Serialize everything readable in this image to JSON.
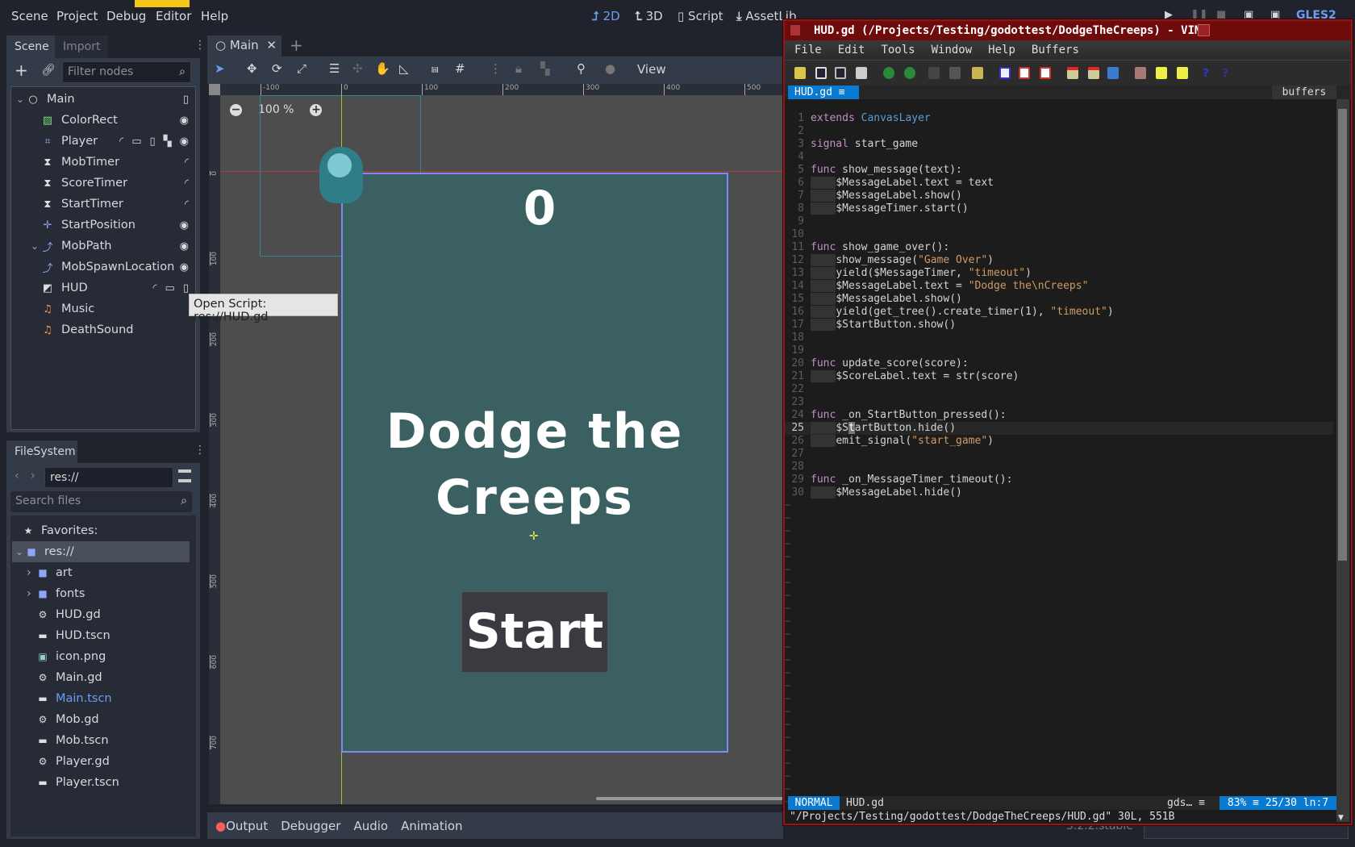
{
  "godot": {
    "menu": [
      "Scene",
      "Project",
      "Debug",
      "Editor",
      "Help"
    ],
    "workspaces": [
      {
        "label": "2D",
        "icon": "2d-icon",
        "active": true
      },
      {
        "label": "3D",
        "icon": "3d-icon"
      },
      {
        "label": "Script",
        "icon": "script-icon"
      },
      {
        "label": "AssetLib",
        "icon": "download-icon"
      }
    ],
    "renderer": "GLES2",
    "scene_dock": {
      "tabs": [
        "Scene",
        "Import"
      ],
      "filter_placeholder": "Filter nodes",
      "tree": [
        {
          "label": "Main",
          "icon": "node-icon",
          "depth": 0,
          "expanded": true,
          "badges": [
            "script-icon"
          ]
        },
        {
          "label": "ColorRect",
          "icon": "colorrect-icon",
          "depth": 1,
          "badges": [
            "visibility-icon"
          ]
        },
        {
          "label": "Player",
          "icon": "area2d-icon",
          "depth": 1,
          "badges": [
            "signal-icon",
            "group-icon",
            "script-icon",
            "lock-group-icon",
            "visibility-icon"
          ]
        },
        {
          "label": "MobTimer",
          "icon": "timer-icon",
          "depth": 1,
          "badges": [
            "signal-icon"
          ]
        },
        {
          "label": "ScoreTimer",
          "icon": "timer-icon",
          "depth": 1,
          "badges": [
            "signal-icon"
          ]
        },
        {
          "label": "StartTimer",
          "icon": "timer-icon",
          "depth": 1,
          "badges": [
            "signal-icon"
          ]
        },
        {
          "label": "StartPosition",
          "icon": "position2d-icon",
          "depth": 1,
          "badges": [
            "visibility-icon"
          ]
        },
        {
          "label": "MobPath",
          "icon": "path2d-icon",
          "depth": 1,
          "expanded": true,
          "badges": [
            "visibility-icon"
          ]
        },
        {
          "label": "MobSpawnLocation",
          "icon": "pathfollow-icon",
          "depth": 2,
          "badges": [
            "visibility-icon"
          ]
        },
        {
          "label": "HUD",
          "icon": "canvaslayer-icon",
          "depth": 1,
          "badges": [
            "signal-icon",
            "group-icon",
            "script-icon"
          ]
        },
        {
          "label": "Music",
          "icon": "audio-icon",
          "depth": 1,
          "badges": []
        },
        {
          "label": "DeathSound",
          "icon": "audio-icon",
          "depth": 1,
          "badges": []
        }
      ],
      "tooltip": "Open Script: res://HUD.gd"
    },
    "filesystem": {
      "tab": "FileSystem",
      "path": "res://",
      "search_placeholder": "Search files",
      "items": [
        {
          "label": "Favorites:",
          "icon": "star-icon",
          "depth": 0
        },
        {
          "label": "res://",
          "icon": "folder-icon",
          "depth": 0,
          "selected": true
        },
        {
          "label": "art",
          "icon": "folder-icon",
          "depth": 1,
          "collapsed": true
        },
        {
          "label": "fonts",
          "icon": "folder-icon",
          "depth": 1,
          "collapsed": true
        },
        {
          "label": "HUD.gd",
          "icon": "gear-icon",
          "depth": 1
        },
        {
          "label": "HUD.tscn",
          "icon": "clapper-icon",
          "depth": 1
        },
        {
          "label": "icon.png",
          "icon": "image-icon",
          "depth": 1
        },
        {
          "label": "Main.gd",
          "icon": "gear-icon",
          "depth": 1
        },
        {
          "label": "Main.tscn",
          "icon": "clapper-icon",
          "depth": 1,
          "highlight": true
        },
        {
          "label": "Mob.gd",
          "icon": "gear-icon",
          "depth": 1
        },
        {
          "label": "Mob.tscn",
          "icon": "clapper-icon",
          "depth": 1
        },
        {
          "label": "Player.gd",
          "icon": "gear-icon",
          "depth": 1
        },
        {
          "label": "Player.tscn",
          "icon": "clapper-icon",
          "depth": 1
        }
      ]
    },
    "editor_tab": "Main",
    "toolbar_view": "View",
    "zoom_label": "100 %",
    "ruler_h": [
      "-100",
      "0",
      "100",
      "200",
      "300",
      "400",
      "500"
    ],
    "ruler_v": [
      "0",
      "100",
      "200",
      "300",
      "400",
      "500",
      "600",
      "700"
    ],
    "game": {
      "score": "0",
      "message": "Dodge the\nCreeps",
      "button": "Start"
    },
    "bottom_tabs": [
      "Output",
      "Debugger",
      "Audio",
      "Animation"
    ],
    "version": "3.2.2.stable",
    "colors": {
      "accent": "#6a9ef5",
      "game_bg": "#3b6062",
      "panel": "#272b36"
    }
  },
  "vim": {
    "title": "HUD.gd (/Projects/Testing/godottest/DodgeTheCreeps) - VIM",
    "menu": [
      "File",
      "Edit",
      "Tools",
      "Window",
      "Help",
      "Buffers"
    ],
    "buffer_tab": "HUD.gd",
    "buffers_label": "buffers",
    "code": [
      [
        [
          "kw",
          "extends"
        ],
        [
          "tx",
          " "
        ],
        [
          "ty",
          "CanvasLayer"
        ]
      ],
      [],
      [
        [
          "kw",
          "signal"
        ],
        [
          "tx",
          " start_game"
        ]
      ],
      [],
      [
        [
          "kw",
          "func"
        ],
        [
          "tx",
          " show_message(text):"
        ]
      ],
      [
        [
          "ind",
          "    "
        ],
        [
          "tx",
          "$MessageLabel.text = text"
        ]
      ],
      [
        [
          "ind",
          "    "
        ],
        [
          "tx",
          "$MessageLabel.show()"
        ]
      ],
      [
        [
          "ind",
          "    "
        ],
        [
          "tx",
          "$MessageTimer.start()"
        ]
      ],
      [],
      [],
      [
        [
          "kw",
          "func"
        ],
        [
          "tx",
          " show_game_over():"
        ]
      ],
      [
        [
          "ind",
          "    "
        ],
        [
          "tx",
          "show_message("
        ],
        [
          "st",
          "\"Game Over\""
        ],
        [
          "tx",
          ")"
        ]
      ],
      [
        [
          "ind",
          "    "
        ],
        [
          "tx",
          "yield($MessageTimer, "
        ],
        [
          "st",
          "\"timeout\""
        ],
        [
          "tx",
          ")"
        ]
      ],
      [
        [
          "ind",
          "    "
        ],
        [
          "tx",
          "$MessageLabel.text = "
        ],
        [
          "st",
          "\"Dodge the\\nCreeps\""
        ]
      ],
      [
        [
          "ind",
          "    "
        ],
        [
          "tx",
          "$MessageLabel.show()"
        ]
      ],
      [
        [
          "ind",
          "    "
        ],
        [
          "tx",
          "yield(get_tree().create_timer(1), "
        ],
        [
          "st",
          "\"timeout\""
        ],
        [
          "tx",
          ")"
        ]
      ],
      [
        [
          "ind",
          "    "
        ],
        [
          "tx",
          "$StartButton.show()"
        ]
      ],
      [],
      [],
      [
        [
          "kw",
          "func"
        ],
        [
          "tx",
          " update_score(score):"
        ]
      ],
      [
        [
          "ind",
          "    "
        ],
        [
          "tx",
          "$ScoreLabel.text = str(score)"
        ]
      ],
      [],
      [],
      [
        [
          "kw",
          "func"
        ],
        [
          "tx",
          " _on_StartButton_pressed():"
        ]
      ],
      [
        [
          "ind",
          "    "
        ],
        [
          "tx",
          "$S"
        ],
        [
          "cur",
          "t"
        ],
        [
          "tx",
          "artButton.hide()"
        ]
      ],
      [
        [
          "ind",
          "    "
        ],
        [
          "tx",
          "emit_signal("
        ],
        [
          "st",
          "\"start_game\""
        ],
        [
          "tx",
          ")"
        ]
      ],
      [],
      [],
      [
        [
          "kw",
          "func"
        ],
        [
          "tx",
          " _on_MessageTimer_timeout():"
        ]
      ],
      [
        [
          "ind",
          "    "
        ],
        [
          "tx",
          "$MessageLabel.hide()"
        ]
      ]
    ],
    "current_line": 25,
    "mode": "NORMAL",
    "status_file": "HUD.gd",
    "filetype": "gds…",
    "position": "83% ≡ 25/30 ln:7",
    "message": "\"/Projects/Testing/godottest/DodgeTheCreeps/HUD.gd\" 30L, 551B"
  }
}
